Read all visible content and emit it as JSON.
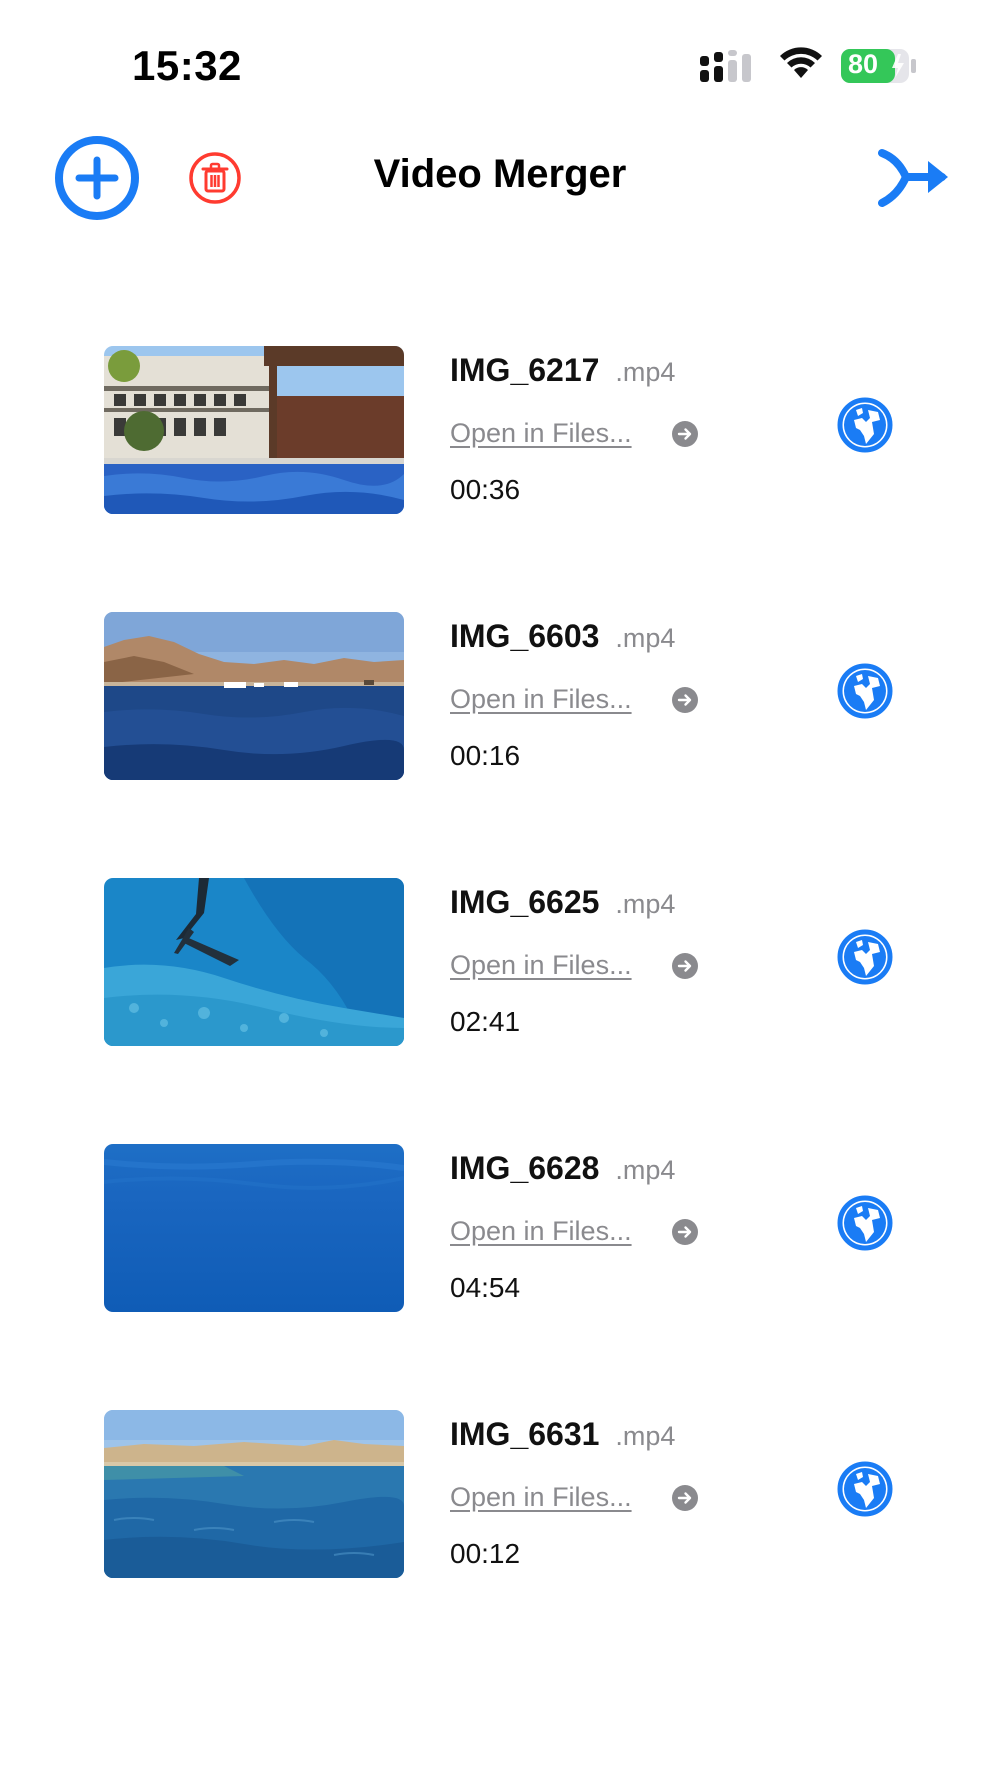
{
  "status_bar": {
    "time": "15:32",
    "battery_level": "80",
    "icons": [
      "signal-icon",
      "wifi-icon",
      "battery-icon"
    ]
  },
  "nav": {
    "title": "Video Merger",
    "add_icon": "plus-circle-icon",
    "delete_icon": "trash-icon",
    "merge_icon": "merge-arrow-icon"
  },
  "colors": {
    "accent": "#1a7cf5",
    "destructive": "#ff3b30",
    "battery_green": "#34c759",
    "secondary_text": "#8a8a8e"
  },
  "videos": [
    {
      "name": "IMG_6217",
      "ext": ".mp4",
      "open_label": "Open in Files...",
      "duration": "00:36",
      "thumbnail": "hotel-pool"
    },
    {
      "name": "IMG_6603",
      "ext": ".mp4",
      "open_label": "Open in Files...",
      "duration": "00:16",
      "thumbnail": "bay-mountains"
    },
    {
      "name": "IMG_6625",
      "ext": ".mp4",
      "open_label": "Open in Files...",
      "duration": "02:41",
      "thumbnail": "underwater-diver"
    },
    {
      "name": "IMG_6628",
      "ext": ".mp4",
      "open_label": "Open in Files...",
      "duration": "04:54",
      "thumbnail": "deep-blue-water"
    },
    {
      "name": "IMG_6631",
      "ext": ".mp4",
      "open_label": "Open in Files...",
      "duration": "00:12",
      "thumbnail": "coast-sea"
    }
  ]
}
